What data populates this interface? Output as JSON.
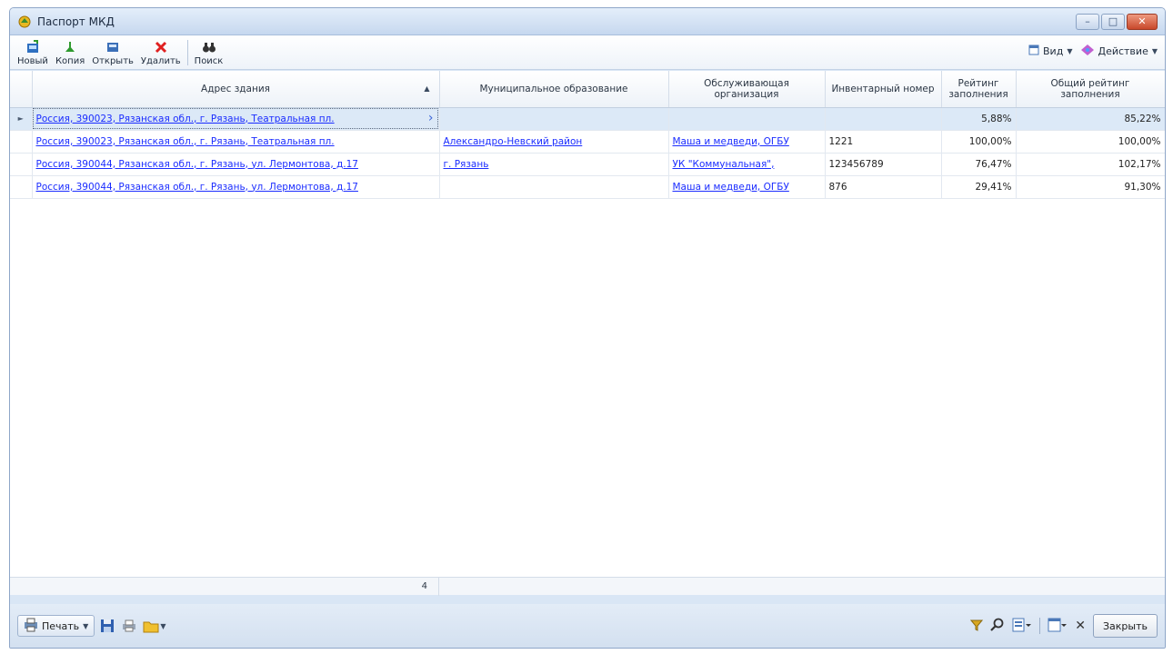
{
  "window": {
    "title": "Паспорт МКД"
  },
  "toolbar": {
    "new_label": "Новый",
    "copy_label": "Копия",
    "open_label": "Открыть",
    "delete_label": "Удалить",
    "search_label": "Поиск",
    "view_label": "Вид",
    "action_label": "Действие"
  },
  "grid": {
    "columns": [
      "Адрес здания",
      "Муниципальное образование",
      "Обслуживающая организация",
      "Инвентарный номер",
      "Рейтинг заполнения",
      "Общий рейтинг заполнения"
    ],
    "sort_column": "Адрес здания",
    "rows": [
      {
        "address": "Россия, 390023, Рязанская обл., г. Рязань, Театральная пл.",
        "municipality": "",
        "organization": "",
        "inventory": "",
        "rating": "5,88%",
        "total_rating": "85,22%"
      },
      {
        "address": "Россия, 390023, Рязанская обл., г. Рязань, Театральная пл.",
        "municipality": "Александро-Невский район",
        "organization": "Маша и медведи, ОГБУ",
        "inventory": "1221",
        "rating": "100,00%",
        "total_rating": "100,00%"
      },
      {
        "address": "Россия, 390044, Рязанская обл., г. Рязань, ул. Лермонтова, д.17",
        "municipality": "г. Рязань",
        "organization": "УК \"Коммунальная\",",
        "inventory": "123456789",
        "rating": "76,47%",
        "total_rating": "102,17%"
      },
      {
        "address": "Россия, 390044, Рязанская обл., г. Рязань, ул. Лермонтова, д.17",
        "municipality": "",
        "organization": "Маша и медведи, ОГБУ",
        "inventory": "876",
        "rating": "29,41%",
        "total_rating": "91,30%"
      }
    ],
    "row_count": "4"
  },
  "bottombar": {
    "print_label": "Печать",
    "close_label": "Закрыть"
  },
  "colors": {
    "link": "#1a2cff",
    "selected_row": "#dce9f7",
    "window_frame": "#8ea6c8"
  }
}
